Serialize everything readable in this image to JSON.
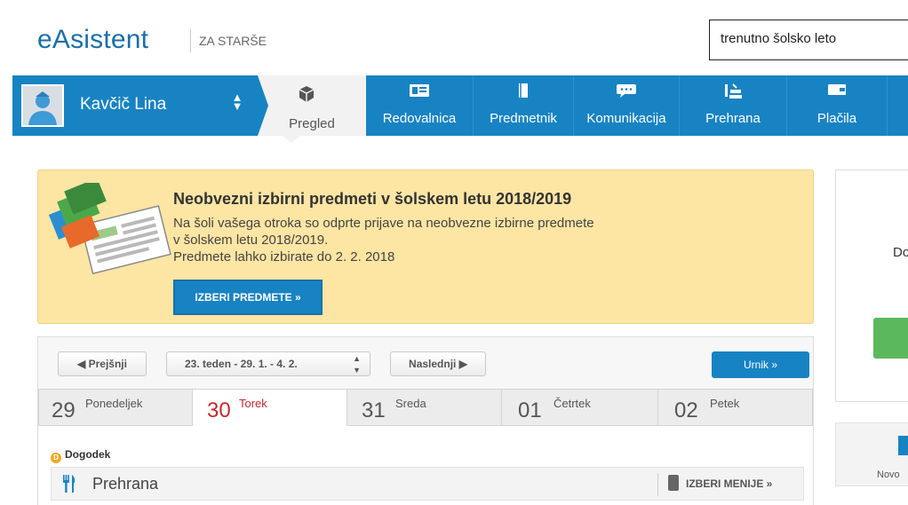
{
  "header": {
    "logo": "eAsistent",
    "logo_sub": "ZA STARŠE",
    "year_select": "trenutno šolsko leto"
  },
  "user": {
    "name": "Kavčič Lina"
  },
  "nav": {
    "active": {
      "label": "Pregled",
      "icon": "cube-icon"
    },
    "items": [
      {
        "label": "Redovalnica",
        "icon": "grade-card-icon"
      },
      {
        "label": "Predmetnik",
        "icon": "book-icon"
      },
      {
        "label": "Komunikacija",
        "icon": "chat-icon"
      },
      {
        "label": "Prehrana",
        "icon": "food-icon"
      },
      {
        "label": "Plačila",
        "icon": "wallet-icon"
      }
    ]
  },
  "notice": {
    "title": "Neobvezni izbirni predmeti v šolskem letu 2018/2019",
    "line1": "Na šoli vašega otroka so odprte prijave na neobvezne izbirne predmete",
    "line2": "v šolskem letu 2018/2019.",
    "line3": "Predmete lahko izbirate do 2. 2. 2018",
    "button": "IZBERI PREDMETE »"
  },
  "right_panel": {
    "text": "Do",
    "bottom_text": "Novo"
  },
  "calendar": {
    "prev": "◀ Prejšnji",
    "week": "23. teden - 29. 1. - 4. 2.",
    "next": "Naslednji ▶",
    "timetable": "Urnik »",
    "days": [
      {
        "num": "29",
        "name": "Ponedeljek",
        "active": false
      },
      {
        "num": "30",
        "name": "Torek",
        "active": true
      },
      {
        "num": "31",
        "name": "Sreda",
        "active": false
      },
      {
        "num": "01",
        "name": "Četrtek",
        "active": false
      },
      {
        "num": "02",
        "name": "Petek",
        "active": false
      }
    ],
    "event_label": "Dogodek",
    "meal_label": "Prehrana",
    "meal_button": "IZBERI MENIJE »"
  },
  "colors": {
    "brand_blue": "#1883c3",
    "notice_bg": "#fde5a3",
    "active_day_red": "#c5282f"
  }
}
